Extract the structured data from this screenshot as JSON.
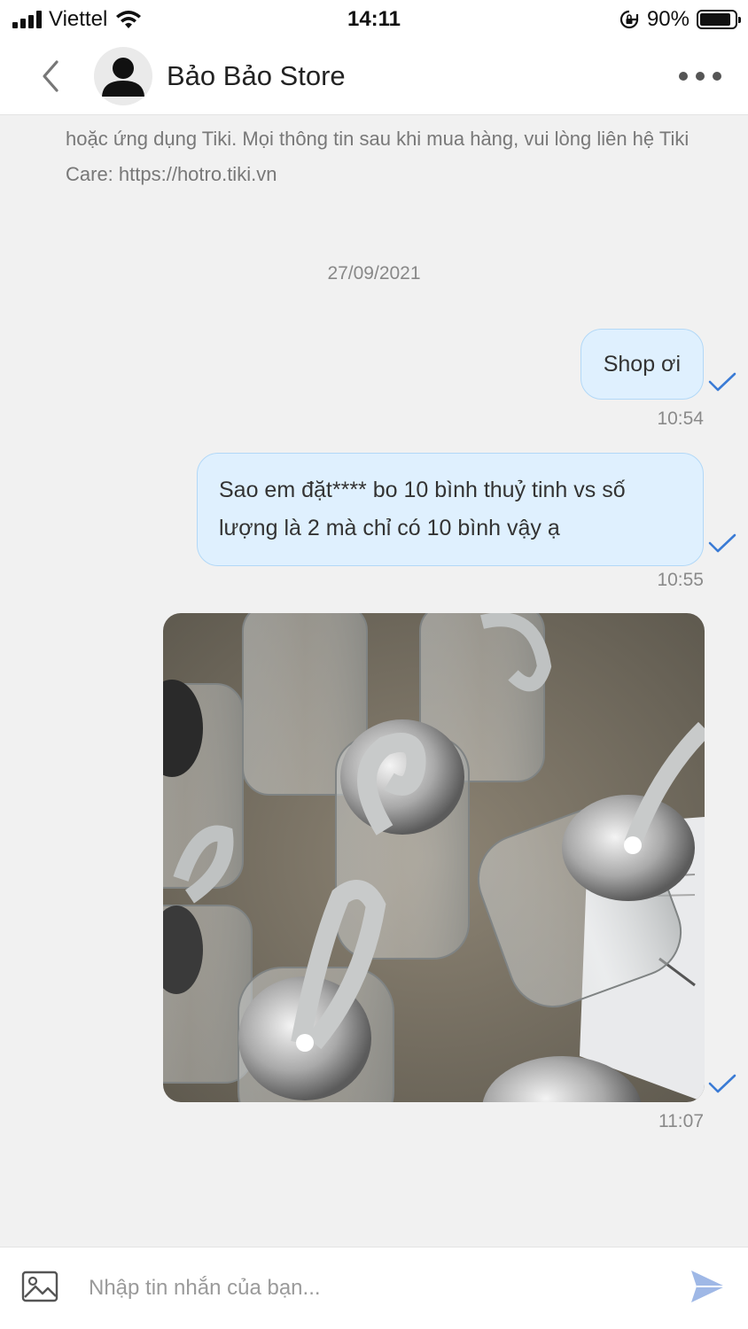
{
  "status_bar": {
    "carrier": "Viettel",
    "time": "14:11",
    "battery_percent": "90%",
    "battery_level": 0.9
  },
  "header": {
    "store_name": "Bảo Bảo Store"
  },
  "chat": {
    "system_message": "hoặc ứng dụng Tiki. Mọi thông tin sau khi mua hàng, vui lòng liên hệ Tiki Care: https://hotro.tiki.vn",
    "date_separator": "27/09/2021",
    "messages": [
      {
        "type": "text",
        "text": "Shop ơi",
        "time": "10:54"
      },
      {
        "type": "text",
        "text": "Sao em đặt**** bo 10 bình thuỷ tinh vs số lượng là 2 mà chỉ có 10 bình vậy ạ",
        "time": "10:55"
      },
      {
        "type": "image",
        "time": "11:07"
      }
    ]
  },
  "input": {
    "placeholder": "Nhập tin nhắn của bạn..."
  },
  "colors": {
    "bubble_bg": "#dff0fe",
    "bubble_border": "#b2d8f7",
    "tick": "#3a7bd5",
    "send": "#9fb8e6"
  }
}
